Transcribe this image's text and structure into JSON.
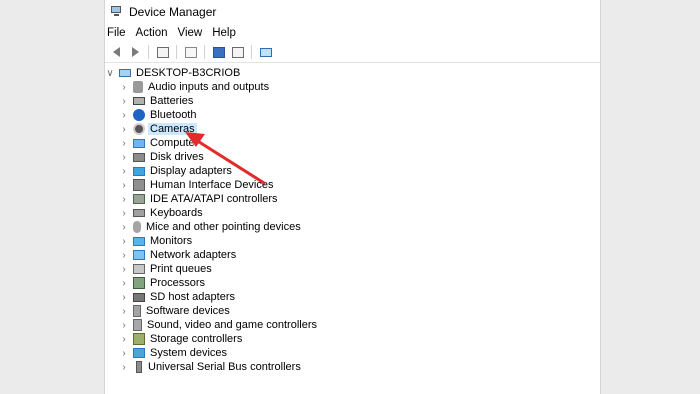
{
  "window": {
    "title": "Device Manager"
  },
  "menu": [
    "File",
    "Action",
    "View",
    "Help"
  ],
  "toolbar": {
    "icons": [
      "back-arrow-icon",
      "forward-arrow-icon",
      "show-hide-tree-icon",
      "properties-icon",
      "help-icon",
      "view-icon",
      "scan-monitor-icon"
    ]
  },
  "tree": {
    "root": "DESKTOP-B3CRIOB",
    "items": [
      {
        "label": "Audio inputs and outputs",
        "icon": "speaker-icon"
      },
      {
        "label": "Batteries",
        "icon": "battery-icon"
      },
      {
        "label": "Bluetooth",
        "icon": "bluetooth-icon"
      },
      {
        "label": "Cameras",
        "icon": "camera-icon",
        "selected": true
      },
      {
        "label": "Computer",
        "icon": "computer-icon"
      },
      {
        "label": "Disk drives",
        "icon": "disk-drive-icon"
      },
      {
        "label": "Display adapters",
        "icon": "display-adapter-icon"
      },
      {
        "label": "Human Interface Devices",
        "icon": "hid-icon"
      },
      {
        "label": "IDE ATA/ATAPI controllers",
        "icon": "ide-controller-icon"
      },
      {
        "label": "Keyboards",
        "icon": "keyboard-icon"
      },
      {
        "label": "Mice and other pointing devices",
        "icon": "mouse-icon"
      },
      {
        "label": "Monitors",
        "icon": "monitor-icon"
      },
      {
        "label": "Network adapters",
        "icon": "network-adapter-icon"
      },
      {
        "label": "Print queues",
        "icon": "printer-icon"
      },
      {
        "label": "Processors",
        "icon": "processor-icon"
      },
      {
        "label": "SD host adapters",
        "icon": "sd-card-icon"
      },
      {
        "label": "Software devices",
        "icon": "software-device-icon"
      },
      {
        "label": "Sound, video and game controllers",
        "icon": "sound-icon"
      },
      {
        "label": "Storage controllers",
        "icon": "storage-controller-icon"
      },
      {
        "label": "System devices",
        "icon": "system-device-icon"
      },
      {
        "label": "Universal Serial Bus controllers",
        "icon": "usb-icon"
      }
    ]
  },
  "colors": {
    "selection": "#cce8ff",
    "annotation_arrow": "#e32b2b"
  }
}
